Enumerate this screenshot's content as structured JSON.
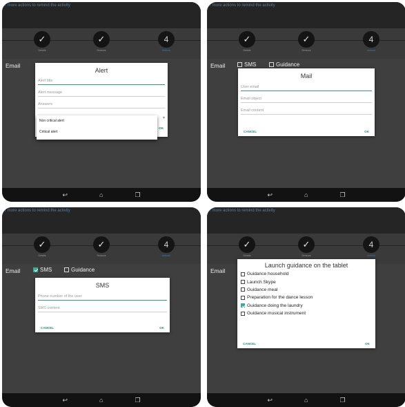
{
  "panels": [
    {
      "topbar_text": "r more actions to remind the activity",
      "steps": [
        "Details",
        "Sensors",
        "Actions"
      ],
      "step_number": "4",
      "email_label": "Email",
      "dialog": {
        "title": "Alert",
        "fields": [
          "Alert title",
          "Alert message",
          "Answers"
        ],
        "dropdown": [
          "Non critical alert",
          "Critical alert"
        ],
        "ok": "OK"
      }
    },
    {
      "topbar_text": "r more actions to remind the activity",
      "steps": [
        "Details",
        "Sensors",
        "Actions"
      ],
      "step_number": "4",
      "email_label": "Email",
      "options": [
        "SMS",
        "Guidance"
      ],
      "dialog": {
        "title": "Mail",
        "fields": [
          "User email",
          "Email object",
          "Email content"
        ],
        "cancel": "CANCEL",
        "ok": "OK"
      }
    },
    {
      "topbar_text": "r more actions to remind the activity",
      "steps": [
        "Details",
        "Sensors",
        "Actions"
      ],
      "step_number": "4",
      "email_label": "Email",
      "options": [
        "SMS",
        "Guidance"
      ],
      "dialog": {
        "title": "SMS",
        "fields": [
          "Phone number of the user",
          "SMS content"
        ],
        "cancel": "CANCEL",
        "ok": "OK"
      }
    },
    {
      "topbar_text": "r more actions to remind the activity",
      "steps": [
        "Details",
        "Sensors",
        "Actions"
      ],
      "step_number": "4",
      "email_label": "Email",
      "dialog": {
        "title": "Launch guidance on the tablet",
        "items": [
          {
            "label": "Guidance household",
            "checked": false
          },
          {
            "label": "Launch Skype",
            "checked": false
          },
          {
            "label": "Guidance meal",
            "checked": false
          },
          {
            "label": "Preparation for the dance lesson",
            "checked": false
          },
          {
            "label": "Guidance doing the laundry",
            "checked": true
          },
          {
            "label": "Guidance musical instrument",
            "checked": false
          }
        ],
        "cancel": "CANCEL",
        "ok": "OK"
      }
    }
  ],
  "nav_icons": [
    "back-icon",
    "home-icon",
    "recents-icon"
  ]
}
